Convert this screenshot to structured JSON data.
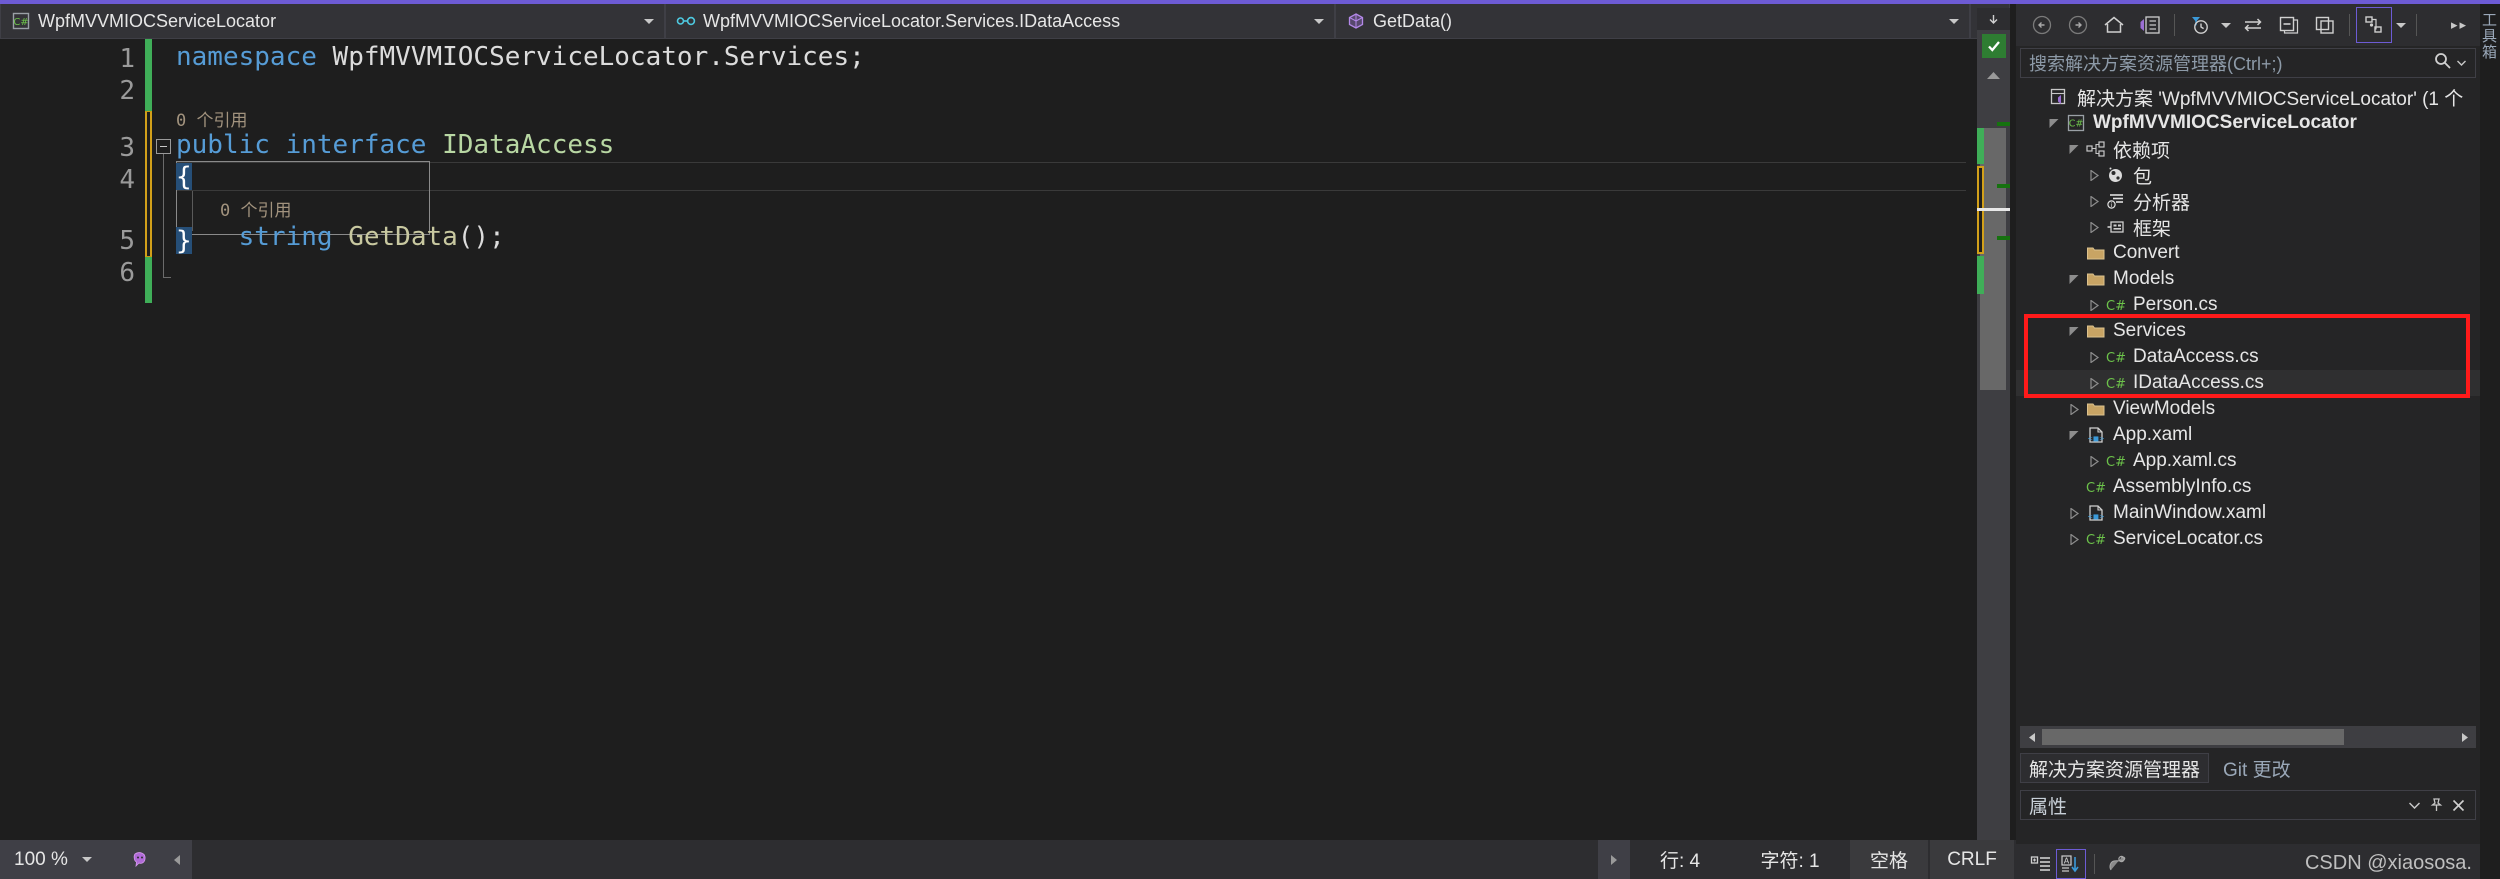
{
  "theme": {
    "accent": "#6d5bd5",
    "editor_bg": "#1e1e1e",
    "panel_bg": "#252526",
    "chrome_bg": "#2d2d30",
    "keyword": "#569cd6",
    "type_name": "#b8d7a3",
    "method": "#c8c8a0",
    "plain_text": "#dcdcdc",
    "codelens": "#a2937e",
    "change_green": "#3fae58",
    "change_gold": "#d2a01a",
    "annotation_red": "#ff1a1a",
    "selection_blue": "#264f78"
  },
  "navbar": {
    "project": {
      "icon": "csharp-project-icon",
      "label": "WpfMVVMIOCServiceLocator"
    },
    "type": {
      "icon": "interface-icon",
      "label": "WpfMVVMIOCServiceLocator.Services.IDataAccess"
    },
    "member": {
      "icon": "method-icon",
      "label": "GetData()"
    },
    "split_button": "horizontal-split-icon"
  },
  "editor": {
    "line_numbers": [
      "1",
      "2",
      "3",
      "4",
      "5",
      "6"
    ],
    "codelens": [
      {
        "text": "0 个引用",
        "line": 3
      },
      {
        "text": "0 个引用",
        "line": 5
      }
    ],
    "code_lines": [
      {
        "n": 1,
        "tokens": [
          {
            "t": "namespace",
            "c": "kw"
          },
          {
            "t": " ",
            "c": "plain"
          },
          {
            "t": "WpfMVVMIOCServiceLocator",
            "c": "plain"
          },
          {
            "t": ".",
            "c": "punc"
          },
          {
            "t": "Services",
            "c": "plain"
          },
          {
            "t": ";",
            "c": "punc"
          }
        ]
      },
      {
        "n": 2,
        "tokens": []
      },
      {
        "n": 3,
        "tokens": [
          {
            "t": "public",
            "c": "kw"
          },
          {
            "t": " ",
            "c": "plain"
          },
          {
            "t": "interface",
            "c": "kw"
          },
          {
            "t": " ",
            "c": "plain"
          },
          {
            "t": "IDataAccess",
            "c": "tname"
          }
        ]
      },
      {
        "n": 4,
        "tokens": [
          {
            "t": "{",
            "c": "punc"
          }
        ]
      },
      {
        "n": 5,
        "tokens": [
          {
            "t": "    ",
            "c": "plain"
          },
          {
            "t": "string",
            "c": "kw"
          },
          {
            "t": " ",
            "c": "plain"
          },
          {
            "t": "GetData",
            "c": "mth"
          },
          {
            "t": "();",
            "c": "punc"
          }
        ]
      },
      {
        "n": 6,
        "tokens": [
          {
            "t": "}",
            "c": "punc"
          }
        ]
      }
    ],
    "squiggle_word": "WpfMVVMIOC",
    "health_indicator": "checkmark-ok-icon"
  },
  "statusbar": {
    "zoom": "100 %",
    "feedback_icon": "feedback-smiley-icon",
    "collapse_icon": "collapse-left-icon",
    "expand_icon": "expand-right-icon",
    "line_label": "行: 4",
    "char_label": "字符: 1",
    "spaces_label": "空格",
    "eol_label": "CRLF"
  },
  "solution_explorer": {
    "toolbar": [
      {
        "name": "back-icon",
        "label": "后退"
      },
      {
        "name": "forward-icon",
        "label": "前进"
      },
      {
        "name": "home-icon",
        "label": "主页"
      },
      {
        "name": "vs-solution-icon",
        "label": "解决方案"
      },
      {
        "name": "pending-changes-clock-icon",
        "label": "挂起的更改筛选器"
      },
      {
        "name": "sync-with-active-document-icon",
        "label": "与活动文档同步"
      },
      {
        "name": "collapse-all-icon",
        "label": "全部折叠"
      },
      {
        "name": "properties-window-icon",
        "label": "属性窗口"
      },
      {
        "name": "show-all-files-icon",
        "label": "显示所有文件"
      }
    ],
    "overflow_icon": "chevron-double-right-icon",
    "search_placeholder": "搜索解决方案资源管理器(Ctrl+;)",
    "search_icon": "search-icon",
    "tree": [
      {
        "id": "solution",
        "depth": 0,
        "twisty": "none",
        "icon": "solution-icon",
        "label": "解决方案 'WpfMVVMIOCServiceLocator' (1 个",
        "bold": false
      },
      {
        "id": "project",
        "depth": 1,
        "twisty": "expanded",
        "icon": "csharp-project-icon",
        "label": "WpfMVVMIOCServiceLocator",
        "bold": true
      },
      {
        "id": "dependencies",
        "depth": 2,
        "twisty": "expanded",
        "icon": "dependencies-icon",
        "label": "依赖项",
        "bold": false
      },
      {
        "id": "packages",
        "depth": 3,
        "twisty": "collapsed",
        "icon": "packages-icon",
        "label": "包",
        "bold": false
      },
      {
        "id": "analyzers",
        "depth": 3,
        "twisty": "collapsed",
        "icon": "analyzers-icon",
        "label": "分析器",
        "bold": false
      },
      {
        "id": "frameworks",
        "depth": 3,
        "twisty": "collapsed",
        "icon": "framework-icon",
        "label": "框架",
        "bold": false
      },
      {
        "id": "convert",
        "depth": 2,
        "twisty": "none",
        "icon": "folder-icon",
        "label": "Convert",
        "bold": false
      },
      {
        "id": "models",
        "depth": 2,
        "twisty": "expanded",
        "icon": "folder-icon",
        "label": "Models",
        "bold": false
      },
      {
        "id": "person-cs",
        "depth": 3,
        "twisty": "collapsed",
        "icon": "csharp-file-icon",
        "label": "Person.cs",
        "bold": false
      },
      {
        "id": "services",
        "depth": 2,
        "twisty": "expanded",
        "icon": "folder-icon",
        "label": "Services",
        "bold": false
      },
      {
        "id": "dataaccess-cs",
        "depth": 3,
        "twisty": "collapsed",
        "icon": "csharp-file-icon",
        "label": "DataAccess.cs",
        "bold": false
      },
      {
        "id": "idataaccess-cs",
        "depth": 3,
        "twisty": "collapsed",
        "icon": "csharp-file-icon",
        "label": "IDataAccess.cs",
        "bold": false,
        "highlighted": true
      },
      {
        "id": "viewmodels",
        "depth": 2,
        "twisty": "collapsed",
        "icon": "folder-icon",
        "label": "ViewModels",
        "bold": false
      },
      {
        "id": "app-xaml",
        "depth": 2,
        "twisty": "expanded",
        "icon": "xaml-file-icon",
        "label": "App.xaml",
        "bold": false
      },
      {
        "id": "app-xaml-cs",
        "depth": 3,
        "twisty": "collapsed",
        "icon": "csharp-file-icon",
        "label": "App.xaml.cs",
        "bold": false
      },
      {
        "id": "assemblyinfo-cs",
        "depth": 2,
        "twisty": "none",
        "icon": "csharp-file-icon",
        "label": "AssemblyInfo.cs",
        "bold": false
      },
      {
        "id": "mainwindow-xaml",
        "depth": 2,
        "twisty": "collapsed",
        "icon": "xaml-file-icon",
        "label": "MainWindow.xaml",
        "bold": false
      },
      {
        "id": "servicelocator-cs",
        "depth": 2,
        "twisty": "collapsed",
        "icon": "csharp-file-icon",
        "label": "ServiceLocator.cs",
        "bold": false
      }
    ],
    "tabs": [
      {
        "label": "解决方案资源管理器",
        "active": true
      },
      {
        "label": "Git 更改",
        "active": false
      }
    ]
  },
  "properties_panel": {
    "title": "属性",
    "dropdown_icon": "chevron-down-icon",
    "pin_icon": "pin-icon",
    "close_icon": "close-icon",
    "toolbar": [
      {
        "name": "categorized-icon",
        "label": "分类"
      },
      {
        "name": "alphabetical-icon",
        "label": "按字母顺序",
        "active": true
      },
      {
        "name": "properties-icon",
        "label": "属性"
      }
    ]
  },
  "far_right_strip": {
    "label": "工具箱"
  },
  "watermark": "CSDN @xiaososa."
}
